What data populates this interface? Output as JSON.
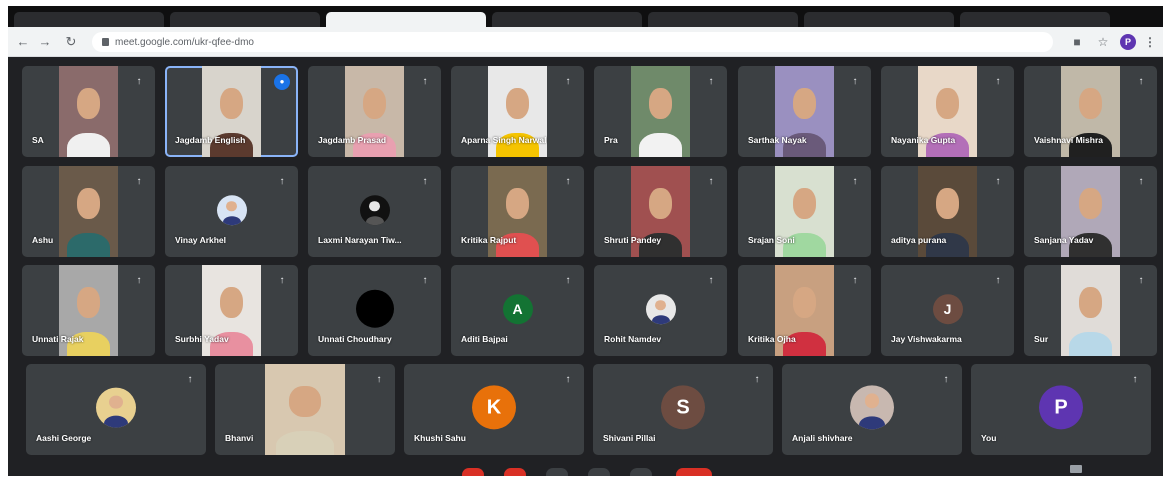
{
  "browser": {
    "url": "meet.google.com/ukr-qfee-dmo",
    "profile_initial": "P"
  },
  "participants": [
    {
      "name": "SA",
      "kind": "video",
      "shirt": "#f0f0f0",
      "wall": "#8a6b6b"
    },
    {
      "name": "Jagdamb English",
      "kind": "video",
      "shirt": "#5b3a2e",
      "wall": "#d8d4cc",
      "speaking": true
    },
    {
      "name": "Jagdamb Prasad",
      "kind": "video",
      "shirt": "#e8a0b0",
      "wall": "#c8b8a8"
    },
    {
      "name": "Aparna Singh Narwal",
      "kind": "video",
      "shirt": "#f5c400",
      "wall": "#e8e8e8"
    },
    {
      "name": "Pra",
      "kind": "video",
      "shirt": "#f2f2f2",
      "wall": "#6f8a6a"
    },
    {
      "name": "Sarthak Nayak",
      "kind": "video",
      "shirt": "#6a5a7a",
      "wall": "#9a90c0"
    },
    {
      "name": "Nayanika Gupta",
      "kind": "video",
      "shirt": "#b36fb8",
      "wall": "#e8d8c8"
    },
    {
      "name": "Vaishnavi Mishra",
      "kind": "video",
      "shirt": "#202020",
      "wall": "#c0b8a8"
    },
    {
      "name": "Ashu",
      "kind": "video",
      "shirt": "#2c6a6a",
      "wall": "#6a5a4a"
    },
    {
      "name": "Vinay Arkhel",
      "kind": "avatar",
      "avatar_style": "photo",
      "avatar_bg": "#d8e4f4",
      "av_size": 30
    },
    {
      "name": "Laxmi Narayan Tiw...",
      "kind": "avatar",
      "avatar_style": "photo-dark",
      "avatar_bg": "#111111",
      "av_size": 30
    },
    {
      "name": "Kritika Rajput",
      "kind": "video",
      "shirt": "#e05050",
      "wall": "#7a6a50"
    },
    {
      "name": "Shruti Pandey",
      "kind": "video",
      "shirt": "#303030",
      "wall": "#a05050"
    },
    {
      "name": "Srajan Soni",
      "kind": "video",
      "shirt": "#a0d8a0",
      "wall": "#d8e0d0"
    },
    {
      "name": "aditya purana",
      "kind": "video",
      "shirt": "#303848",
      "wall": "#5a4a3a"
    },
    {
      "name": "Sanjana Yadav",
      "kind": "video",
      "shirt": "#303030",
      "wall": "#b0a8b8"
    },
    {
      "name": "Unnati Rajak",
      "kind": "video",
      "shirt": "#e8d060",
      "wall": "#a8a8a8"
    },
    {
      "name": "Surbhi Yadav",
      "kind": "video",
      "shirt": "#e890a0",
      "wall": "#e8e4e0"
    },
    {
      "name": "Unnati Choudhary",
      "kind": "avatar",
      "avatar_style": "solid",
      "avatar_bg": "#000000",
      "av_size": 38
    },
    {
      "name": "Aditi Bajpai",
      "kind": "avatar",
      "avatar_style": "letter",
      "letter": "A",
      "avatar_bg": "#137333",
      "av_size": 30
    },
    {
      "name": "Rohit Namdev",
      "kind": "avatar",
      "avatar_style": "photo",
      "avatar_bg": "#e8e8e8",
      "av_size": 30
    },
    {
      "name": "Kritika Ojha",
      "kind": "video",
      "shirt": "#d03040",
      "wall": "#c8a080"
    },
    {
      "name": "Jay Vishwakarma",
      "kind": "avatar",
      "avatar_style": "letter",
      "letter": "J",
      "avatar_bg": "#6d4c41",
      "av_size": 30
    },
    {
      "name": "Sur",
      "kind": "video",
      "shirt": "#b8d8e8",
      "wall": "#e0dcd8"
    },
    {
      "name": "Aashi George",
      "kind": "avatar",
      "avatar_style": "photo",
      "avatar_bg": "#e8d090",
      "av_size": 40
    },
    {
      "name": "Bhanvi",
      "kind": "video",
      "shirt": "#d8d0b8",
      "wall": "#d8c8b0"
    },
    {
      "name": "Khushi Sahu",
      "kind": "avatar",
      "avatar_style": "letter",
      "letter": "K",
      "avatar_bg": "#e8710a",
      "av_size": 44
    },
    {
      "name": "Shivani Pillai",
      "kind": "avatar",
      "avatar_style": "letter",
      "letter": "S",
      "avatar_bg": "#6d4c41",
      "av_size": 44
    },
    {
      "name": "Anjali shivhare",
      "kind": "avatar",
      "avatar_style": "photo",
      "avatar_bg": "#c8b8b0",
      "av_size": 44
    },
    {
      "name": "You",
      "kind": "avatar",
      "avatar_style": "letter",
      "letter": "P",
      "avatar_bg": "#5e35b1",
      "av_size": 44
    }
  ],
  "colors": {
    "meet_background": "#202124",
    "tile_background": "#3c4043",
    "control_red": "#d93025",
    "control_grey": "#3c4043",
    "speaking_accent": "#1a73e8"
  },
  "icons": {
    "pin": "pin-icon",
    "speaking": "mic-active-icon"
  }
}
